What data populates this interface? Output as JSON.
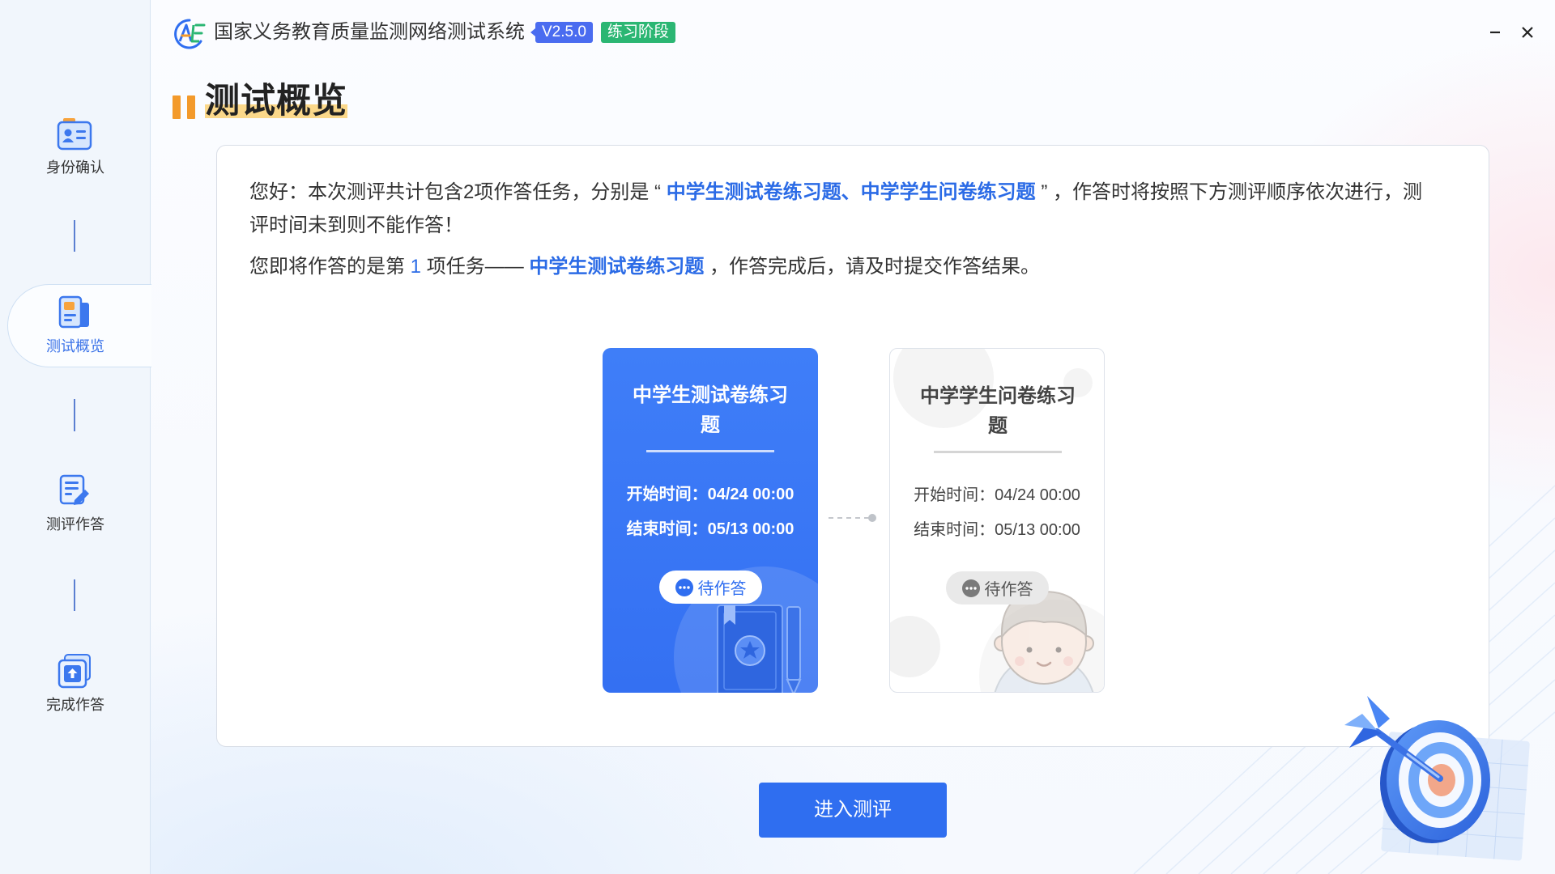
{
  "colors": {
    "accent": "#2f6ef0",
    "card_blue": "#3a77f6",
    "highlight_text": "#2b6be6",
    "version_badge": "#4a6cf0",
    "stage_badge": "#2bb673",
    "title_bars": "#f39a2b"
  },
  "header": {
    "logo_icon": "system-logo-icon",
    "title": "国家义务教育质量监测网络测试系统",
    "version": "V2.5.0",
    "stage": "练习阶段",
    "controls": {
      "minimize_icon": "minimize-icon",
      "close_icon": "close-icon"
    }
  },
  "sidebar": {
    "active_index": 1,
    "items": [
      {
        "label": "身份确认",
        "icon": "id-card-icon"
      },
      {
        "label": "测试概览",
        "icon": "overview-document-icon"
      },
      {
        "label": "测评作答",
        "icon": "edit-document-icon"
      },
      {
        "label": "完成作答",
        "icon": "upload-submit-icon"
      }
    ]
  },
  "page": {
    "title": "测试概览"
  },
  "intro": {
    "p1": {
      "before": "您好：本次测评共计包含2项作答任务，分别是 “ ",
      "highlight": "中学生测试卷练习题、中学学生问卷练习题",
      "after": " ” ，作答时将按照下方测评顺序依次进行，测评时间未到则不能作答！"
    },
    "p2": {
      "before": "您即将作答的是第 ",
      "task_number": "1",
      "middle": " 项任务—— ",
      "highlight": "中学生测试卷练习题",
      "after": " ，作答完成后，请及时提交作答结果。"
    }
  },
  "tasks": [
    {
      "title": "中学生测试卷练习题",
      "start_label": "开始时间：",
      "start_time": "04/24 00:00",
      "end_label": "结束时间：",
      "end_time": "05/13 00:00",
      "status": "待作答",
      "status_icon": "more-dots-icon",
      "current": true
    },
    {
      "title": "中学学生问卷练习题",
      "start_label": "开始时间：",
      "start_time": "04/24 00:00",
      "end_label": "结束时间：",
      "end_time": "05/13 00:00",
      "status": "待作答",
      "status_icon": "more-dots-icon",
      "current": false
    }
  ],
  "actions": {
    "enter_label": "进入测评"
  }
}
